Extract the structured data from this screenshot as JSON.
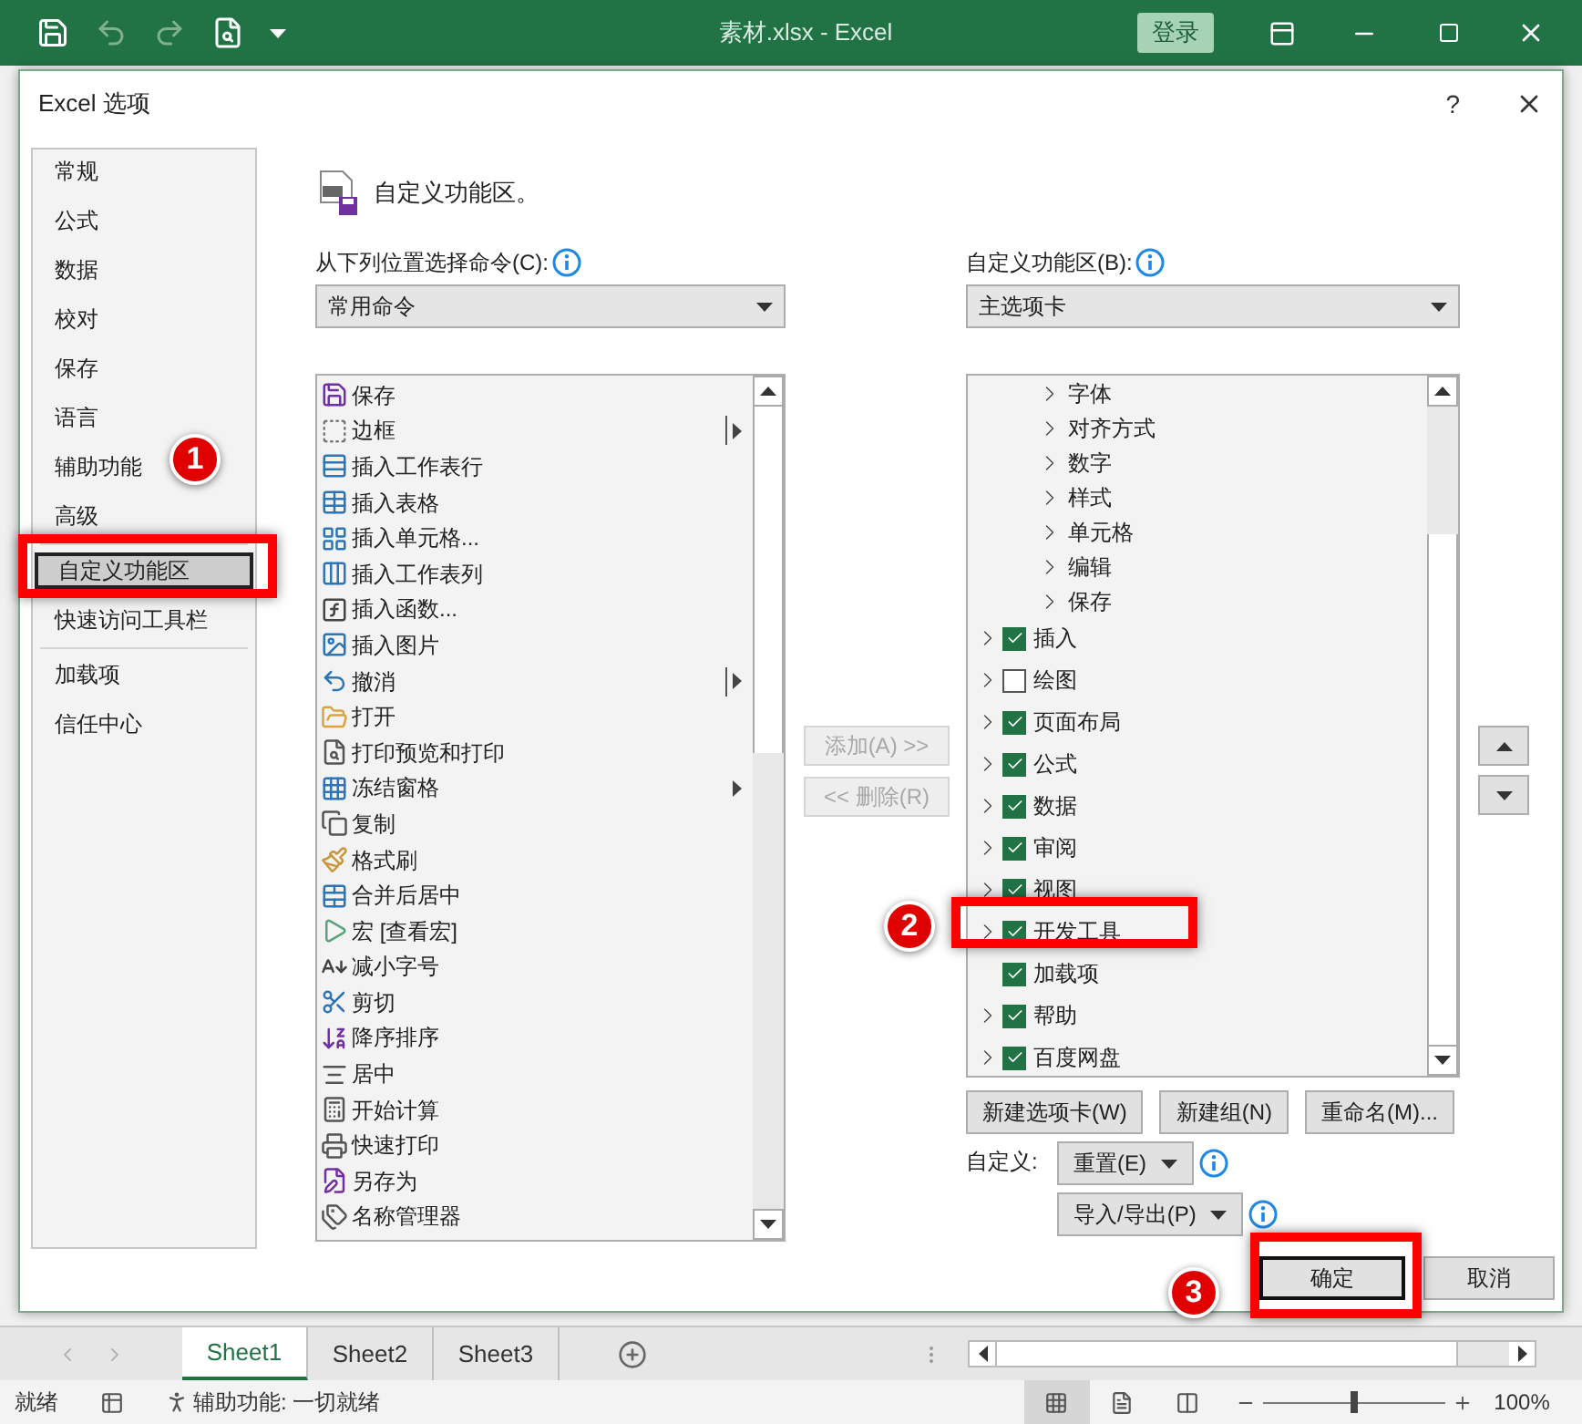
{
  "titlebar": {
    "title": "素材.xlsx - Excel",
    "login": "登录",
    "quick_access": [
      {
        "kind": "save",
        "disabled": false
      },
      {
        "kind": "undo",
        "disabled": true
      },
      {
        "kind": "redo",
        "disabled": true
      },
      {
        "kind": "print_preview",
        "disabled": false
      },
      {
        "kind": "customize",
        "disabled": false
      }
    ]
  },
  "dialog": {
    "title": "Excel 选项",
    "help": "?"
  },
  "sidebar": {
    "groups": [
      {
        "items": [
          {
            "label": "常规",
            "selected": false
          },
          {
            "label": "公式",
            "selected": false
          },
          {
            "label": "数据",
            "selected": false
          },
          {
            "label": "校对",
            "selected": false
          },
          {
            "label": "保存",
            "selected": false
          },
          {
            "label": "语言",
            "selected": false
          },
          {
            "label": "辅助功能",
            "selected": false
          },
          {
            "label": "高级",
            "selected": false
          }
        ]
      },
      {
        "items": [
          {
            "label": "自定义功能区",
            "selected": true
          },
          {
            "label": "快速访问工具栏",
            "selected": false
          }
        ]
      },
      {
        "items": [
          {
            "label": "加载项",
            "selected": false
          },
          {
            "label": "信任中心",
            "selected": false
          }
        ]
      }
    ]
  },
  "header": {
    "title": "自定义功能区。"
  },
  "commands": {
    "label": "从下列位置选择命令(C):",
    "dropdown": "常用命令",
    "items": [
      {
        "label": "保存",
        "kind": "plain"
      },
      {
        "label": "边框",
        "kind": "split"
      },
      {
        "label": "插入工作表行",
        "kind": "plain"
      },
      {
        "label": "插入表格",
        "kind": "plain"
      },
      {
        "label": "插入单元格...",
        "kind": "plain"
      },
      {
        "label": "插入工作表列",
        "kind": "plain"
      },
      {
        "label": "插入函数...",
        "kind": "plain"
      },
      {
        "label": "插入图片",
        "kind": "plain"
      },
      {
        "label": "撤消",
        "kind": "split"
      },
      {
        "label": "打开",
        "kind": "plain"
      },
      {
        "label": "打印预览和打印",
        "kind": "plain"
      },
      {
        "label": "冻结窗格",
        "kind": "arrow"
      },
      {
        "label": "复制",
        "kind": "plain"
      },
      {
        "label": "格式刷",
        "kind": "plain"
      },
      {
        "label": "合并后居中",
        "kind": "plain"
      },
      {
        "label": "宏 [查看宏]",
        "kind": "plain"
      },
      {
        "label": "减小字号",
        "kind": "plain"
      },
      {
        "label": "剪切",
        "kind": "plain"
      },
      {
        "label": "降序排序",
        "kind": "plain"
      },
      {
        "label": "居中",
        "kind": "plain"
      },
      {
        "label": "开始计算",
        "kind": "plain"
      },
      {
        "label": "快速打印",
        "kind": "plain"
      },
      {
        "label": "另存为",
        "kind": "plain"
      },
      {
        "label": "名称管理器",
        "kind": "plain"
      }
    ]
  },
  "transfer_buttons": [
    {
      "label": "添加(A) >>",
      "disabled": true
    },
    {
      "label": "<< 删除(R)",
      "disabled": true
    }
  ],
  "ribbon": {
    "label": "自定义功能区(B):",
    "dropdown": "主选项卡",
    "scrolled_parent_children": [
      "字体",
      "对齐方式",
      "数字",
      "样式",
      "单元格",
      "编辑",
      "保存"
    ],
    "tabs": [
      {
        "label": "插入",
        "checked": true,
        "expandable": true
      },
      {
        "label": "绘图",
        "checked": false,
        "expandable": true
      },
      {
        "label": "页面布局",
        "checked": true,
        "expandable": true
      },
      {
        "label": "公式",
        "checked": true,
        "expandable": true
      },
      {
        "label": "数据",
        "checked": true,
        "expandable": true
      },
      {
        "label": "审阅",
        "checked": true,
        "expandable": true
      },
      {
        "label": "视图",
        "checked": true,
        "expandable": true
      },
      {
        "label": "开发工具",
        "checked": true,
        "expandable": true
      },
      {
        "label": "加载项",
        "checked": true,
        "expandable": false
      },
      {
        "label": "帮助",
        "checked": true,
        "expandable": true
      },
      {
        "label": "百度网盘",
        "checked": true,
        "expandable": true
      }
    ]
  },
  "tree_buttons": [
    "新建选项卡(W)",
    "新建组(N)",
    "重命名(M)..."
  ],
  "customize": {
    "label": "自定义:",
    "reset": "重置(E)",
    "import_export": "导入/导出(P)"
  },
  "footer": {
    "ok": "确定",
    "cancel": "取消"
  },
  "sheet_tabs": [
    {
      "label": "Sheet1",
      "selected": true
    },
    {
      "label": "Sheet2",
      "selected": false
    },
    {
      "label": "Sheet3",
      "selected": false
    }
  ],
  "status": {
    "ready": "就绪",
    "accessibility": "辅助功能: 一切就绪",
    "zoom": "100%",
    "zoom_slider": {
      "level": 0.5
    },
    "views": [
      {
        "kind": "normal",
        "selected": true
      },
      {
        "kind": "page_layout",
        "selected": false
      },
      {
        "kind": "page_break",
        "selected": false
      }
    ]
  },
  "annotations": [
    {
      "label": "1"
    },
    {
      "label": "2"
    },
    {
      "label": "3"
    }
  ]
}
